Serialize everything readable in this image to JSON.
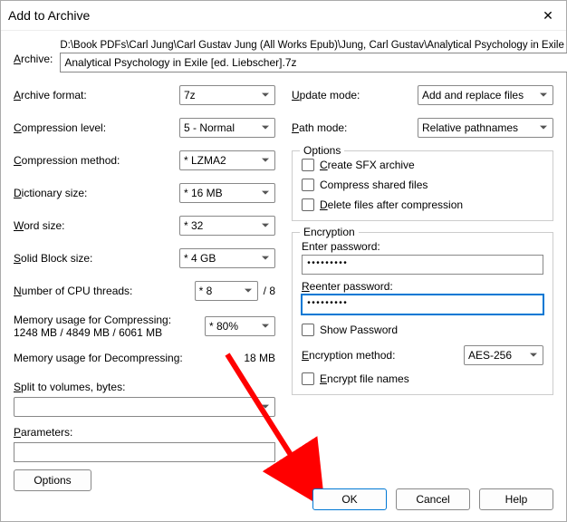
{
  "title": "Add to Archive",
  "archive": {
    "label": "Archive:",
    "path": "D:\\Book PDFs\\Carl Jung\\Carl Gustav Jung (All Works Epub)\\Jung, Carl Gustav\\Analytical Psychology in Exile [ed.",
    "filename": "Analytical Psychology in Exile [ed. Liebscher].7z",
    "browse": "..."
  },
  "left": {
    "format": {
      "label": "Archive format:",
      "value": "7z"
    },
    "level": {
      "label": "Compression level:",
      "value": "5 - Normal"
    },
    "method": {
      "label": "Compression method:",
      "value": "* LZMA2"
    },
    "dict": {
      "label": "Dictionary size:",
      "value": "* 16 MB"
    },
    "word": {
      "label": "Word size:",
      "value": "* 32"
    },
    "block": {
      "label": "Solid Block size:",
      "value": "* 4 GB"
    },
    "threads": {
      "label": "Number of CPU threads:",
      "value": "* 8",
      "total": "/ 8"
    },
    "mem_comp_label": "Memory usage for Compressing:",
    "mem_comp_value": "1248 MB / 4849 MB / 6061 MB",
    "mem_pct": "* 80%",
    "mem_decomp_label": "Memory usage for Decompressing:",
    "mem_decomp_value": "18 MB",
    "split_label": "Split to volumes, bytes:",
    "param_label": "Parameters:",
    "options_btn": "Options"
  },
  "right": {
    "update": {
      "label": "Update mode:",
      "value": "Add and replace files"
    },
    "pathmode": {
      "label": "Path mode:",
      "value": "Relative pathnames"
    },
    "options_legend": "Options",
    "opt_sfx": "Create SFX archive",
    "opt_shared": "Compress shared files",
    "opt_delete": "Delete files after compression",
    "enc_legend": "Encryption",
    "enter_pw": "Enter password:",
    "reenter_pw": "Reenter password:",
    "pw_mask": "•••••••••",
    "show_pw": "Show Password",
    "enc_method_label": "Encryption method:",
    "enc_method_value": "AES-256",
    "encrypt_names": "Encrypt file names"
  },
  "buttons": {
    "ok": "OK",
    "cancel": "Cancel",
    "help": "Help"
  }
}
